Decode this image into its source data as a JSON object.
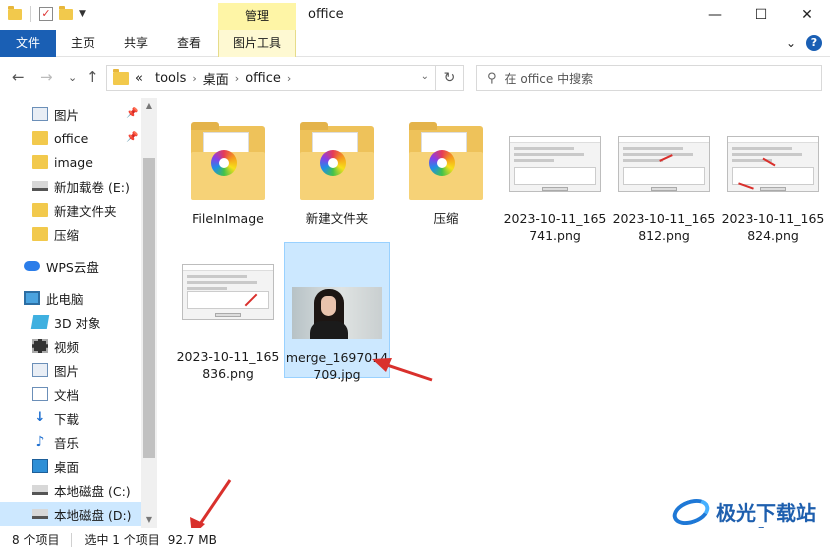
{
  "titlebar": {
    "context_tab": "管理",
    "title": "office",
    "controls": {
      "minimize": "—",
      "maximize": "☐",
      "close": "✕"
    }
  },
  "ribbon": {
    "tabs": [
      "文件",
      "主页",
      "共享",
      "查看",
      "图片工具"
    ],
    "chevron": "⌄",
    "help": "?"
  },
  "nav": {
    "back": "←",
    "forward": "→",
    "recent": "⌄",
    "up": "↑",
    "address_prefix": "«",
    "crumbs": [
      "tools",
      "桌面",
      "office"
    ],
    "search_placeholder": "在 office 中搜索"
  },
  "sidebar": {
    "items": [
      {
        "label": "图片",
        "icon": "pictures-icon",
        "pinned": true
      },
      {
        "label": "office",
        "icon": "folder-icon",
        "pinned": true
      },
      {
        "label": "image",
        "icon": "folder-icon",
        "pinned": false
      },
      {
        "label": "新加载卷 (E:)",
        "icon": "drive-icon",
        "pinned": false
      },
      {
        "label": "新建文件夹",
        "icon": "folder-icon",
        "pinned": false
      },
      {
        "label": "压缩",
        "icon": "folder-icon",
        "pinned": false
      },
      {
        "label": "WPS云盘",
        "icon": "cloud-icon",
        "pinned": false
      },
      {
        "label": "此电脑",
        "icon": "pc-icon",
        "pinned": false
      },
      {
        "label": "3D 对象",
        "icon": "3d-objects-icon",
        "pinned": false
      },
      {
        "label": "视频",
        "icon": "video-icon",
        "pinned": false
      },
      {
        "label": "图片",
        "icon": "pictures-icon",
        "pinned": false
      },
      {
        "label": "文档",
        "icon": "documents-icon",
        "pinned": false
      },
      {
        "label": "下载",
        "icon": "downloads-icon",
        "pinned": false
      },
      {
        "label": "音乐",
        "icon": "music-icon",
        "pinned": false
      },
      {
        "label": "桌面",
        "icon": "desktop-icon",
        "pinned": false
      },
      {
        "label": "本地磁盘 (C:)",
        "icon": "drive-icon",
        "pinned": false
      },
      {
        "label": "本地磁盘 (D:)",
        "icon": "drive-icon",
        "pinned": false
      }
    ]
  },
  "files": [
    {
      "name_line1": "FileInImage",
      "name_line2": "",
      "type": "folder"
    },
    {
      "name_line1": "新建文件夹",
      "name_line2": "",
      "type": "folder"
    },
    {
      "name_line1": "压缩",
      "name_line2": "",
      "type": "folder"
    },
    {
      "name_line1": "2023-10-11_165",
      "name_line2": "741.png",
      "type": "screenshot"
    },
    {
      "name_line1": "2023-10-11_165",
      "name_line2": "812.png",
      "type": "screenshot"
    },
    {
      "name_line1": "2023-10-11_165",
      "name_line2": "824.png",
      "type": "screenshot"
    },
    {
      "name_line1": "2023-10-11_165",
      "name_line2": "836.png",
      "type": "screenshot"
    },
    {
      "name_line1": "merge_1697014",
      "name_line2": "709.jpg",
      "type": "photo",
      "selected": true
    }
  ],
  "status": {
    "count": "8 个项目",
    "selection": "选中 1 个项目",
    "size": "92.7 MB"
  },
  "watermark": {
    "text": "极光下载站",
    "url": "www.xz7.com"
  },
  "colors": {
    "file_tab": "#1a5fb4",
    "context_tab": "#fef5a6",
    "selection": "#cce8ff",
    "annotation_red": "#d9302c"
  }
}
